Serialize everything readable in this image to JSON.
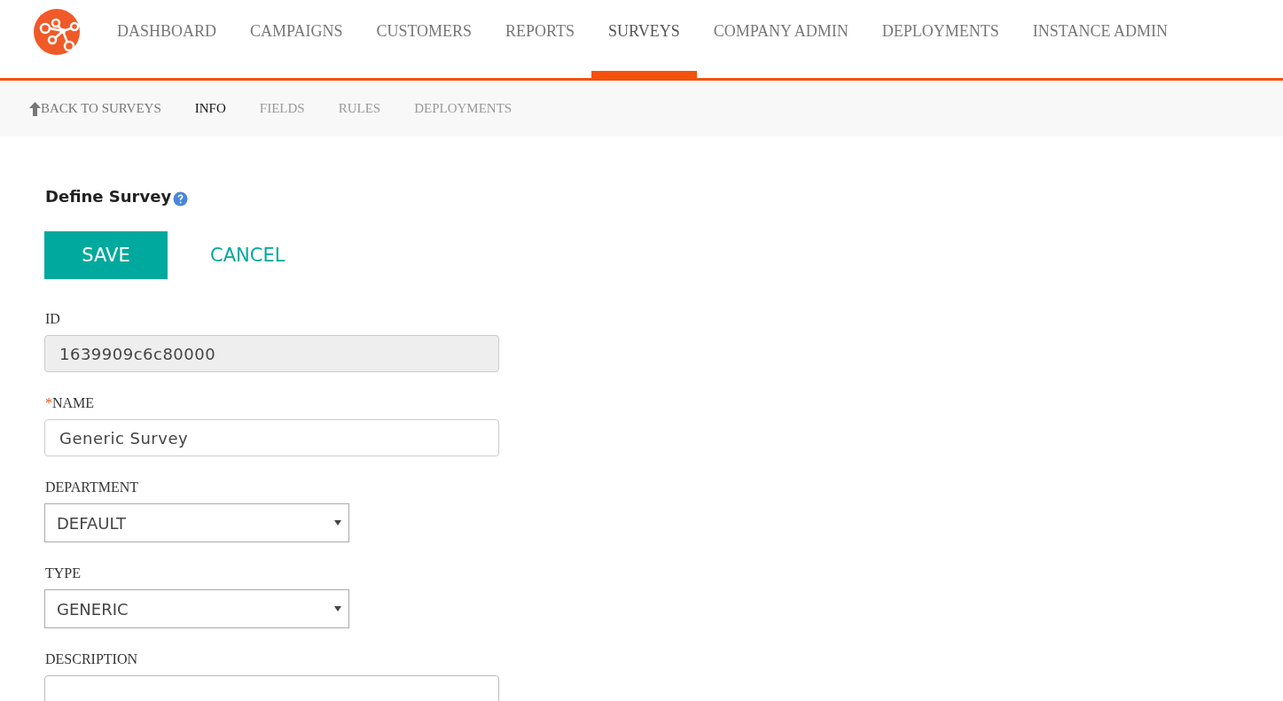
{
  "nav": {
    "items": [
      {
        "label": "DASHBOARD",
        "selected": false
      },
      {
        "label": "CAMPAIGNS",
        "selected": false
      },
      {
        "label": "CUSTOMERS",
        "selected": false
      },
      {
        "label": "REPORTS",
        "selected": false
      },
      {
        "label": "SURVEYS",
        "selected": true
      },
      {
        "label": "COMPANY ADMIN",
        "selected": false
      },
      {
        "label": "DEPLOYMENTS",
        "selected": false
      },
      {
        "label": "INSTANCE ADMIN",
        "selected": false
      }
    ]
  },
  "subnav": {
    "back": "BACK TO SURVEYS",
    "tabs": [
      {
        "label": "INFO",
        "selected": true
      },
      {
        "label": "FIELDS",
        "selected": false
      },
      {
        "label": "RULES",
        "selected": false
      },
      {
        "label": "DEPLOYMENTS",
        "selected": false
      }
    ]
  },
  "form": {
    "title": "Define Survey",
    "required_mark": "*",
    "save": "SAVE",
    "cancel": "CANCEL",
    "fields": [
      {
        "kind": "readonly",
        "label": "ID",
        "required": false,
        "value": "1639909c6c80000"
      },
      {
        "kind": "text",
        "label": "NAME",
        "required": true,
        "value": "Generic Survey"
      },
      {
        "kind": "select",
        "label": "DEPARTMENT",
        "required": false,
        "value": "DEFAULT"
      },
      {
        "kind": "select",
        "label": "TYPE",
        "required": false,
        "value": "GENERIC"
      },
      {
        "kind": "textarea",
        "label": "DESCRIPTION",
        "required": false
      }
    ]
  }
}
